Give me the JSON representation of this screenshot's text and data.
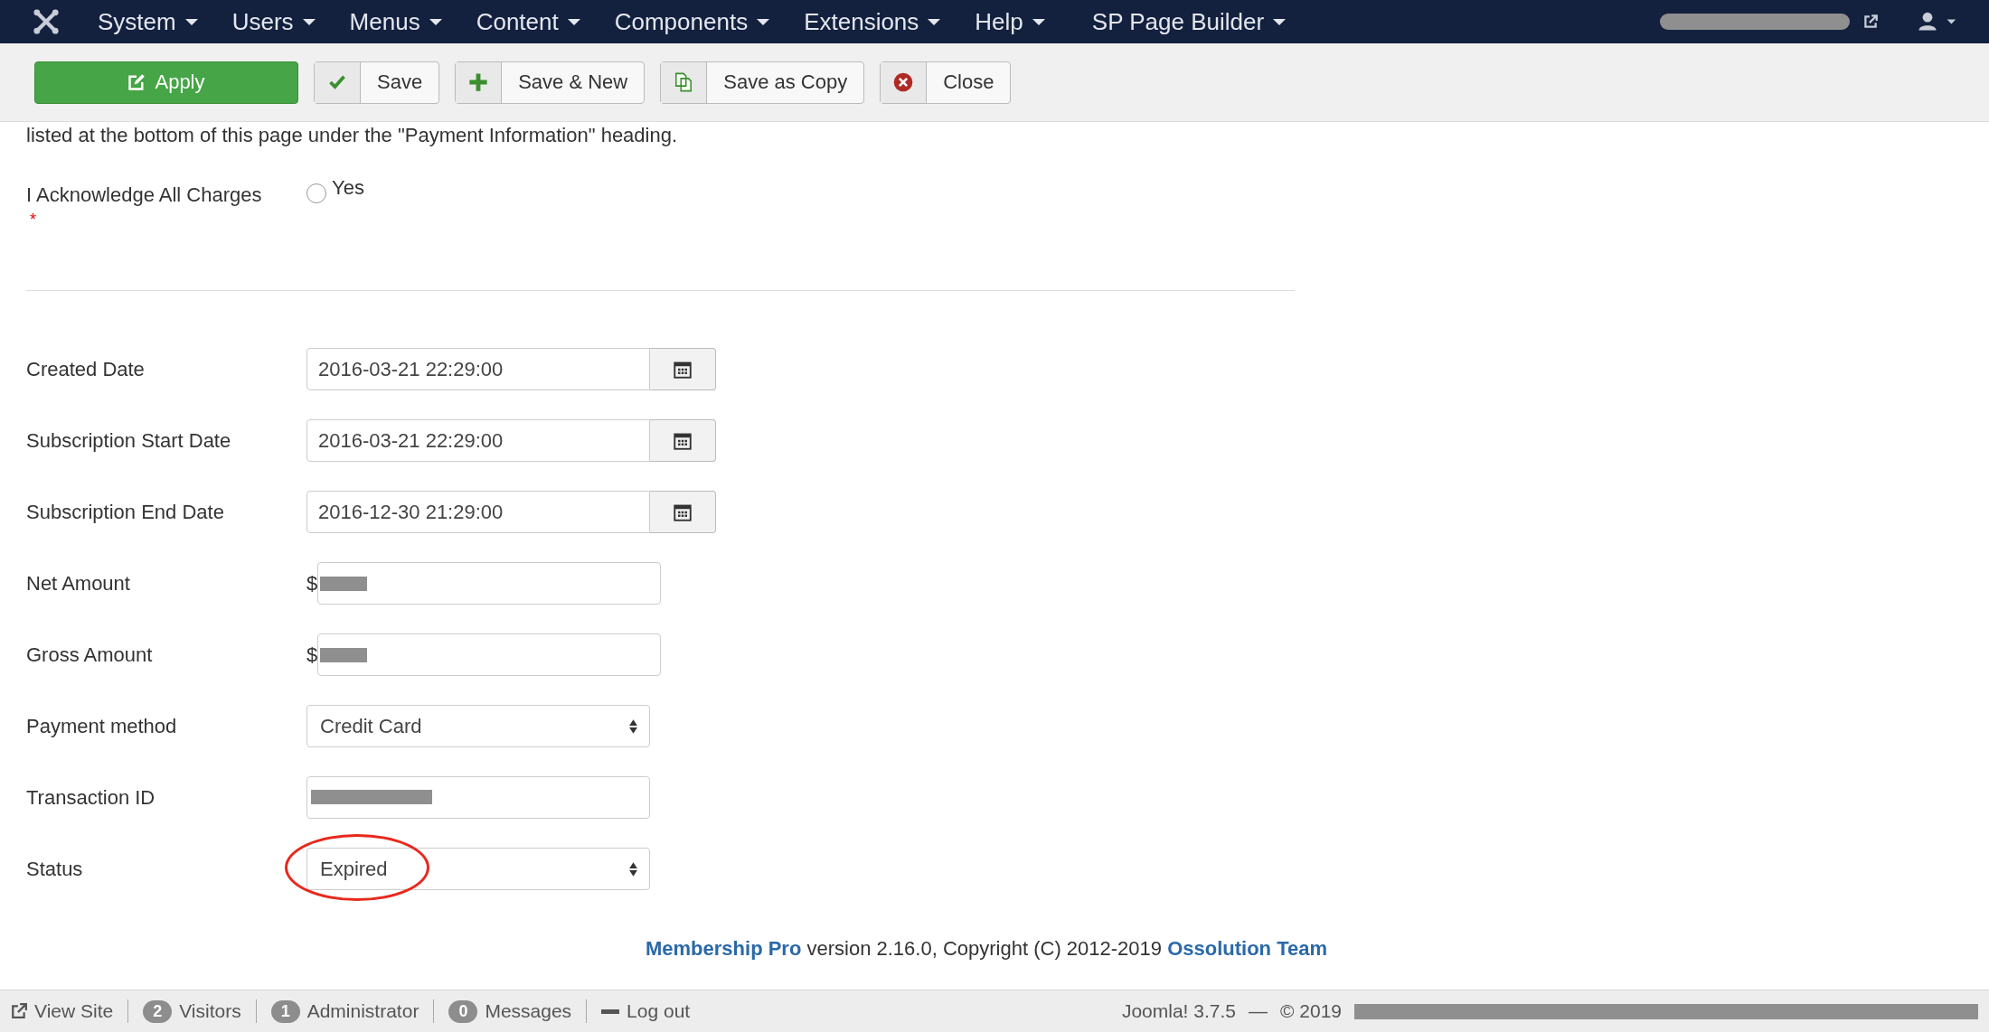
{
  "navbar": {
    "menus": [
      {
        "label": "System"
      },
      {
        "label": "Users"
      },
      {
        "label": "Menus"
      },
      {
        "label": "Content"
      },
      {
        "label": "Components"
      },
      {
        "label": "Extensions"
      },
      {
        "label": "Help"
      },
      {
        "label": "SP Page Builder"
      }
    ],
    "site_link": {
      "redacted": true
    }
  },
  "toolbar": {
    "buttons": [
      {
        "label": "Apply",
        "kind": "apply"
      },
      {
        "label": "Save",
        "kind": "save"
      },
      {
        "label": "Save & New",
        "kind": "new"
      },
      {
        "label": "Save as Copy",
        "kind": "copy"
      },
      {
        "label": "Close",
        "kind": "close"
      }
    ]
  },
  "intro_text": "listed at the bottom of this page under the \"Payment Information\" heading.",
  "acknowledge": {
    "label": "I Acknowledge All Charges",
    "required_mark": "*",
    "option": "Yes",
    "checked": false
  },
  "fields": [
    {
      "label": "Created Date",
      "kind": "date",
      "value": "2016-03-21 22:29:00"
    },
    {
      "label": "Subscription Start Date",
      "kind": "date",
      "value": "2016-03-21 22:29:00"
    },
    {
      "label": "Subscription End Date",
      "kind": "date",
      "value": "2016-12-30 21:29:00"
    },
    {
      "label": "Net Amount",
      "kind": "amount",
      "prefix": "$",
      "redacted": true
    },
    {
      "label": "Gross Amount",
      "kind": "amount",
      "prefix": "$",
      "redacted": true
    },
    {
      "label": "Payment method",
      "kind": "select",
      "value": "Credit Card"
    },
    {
      "label": "Transaction ID",
      "kind": "text",
      "redacted": true
    },
    {
      "label": "Status",
      "kind": "select",
      "value": "Expired",
      "circled": true
    }
  ],
  "footer": {
    "product": "Membership Pro",
    "text": "version 2.16.0, Copyright (C) 2012-2019",
    "team": "Ossolution Team"
  },
  "status_bar": {
    "items": [
      {
        "kind": "view",
        "label": "View Site"
      },
      {
        "kind": "badge",
        "count": "2",
        "label": "Visitors"
      },
      {
        "kind": "badge",
        "count": "1",
        "label": "Administrator"
      },
      {
        "kind": "badge",
        "count": "0",
        "label": "Messages"
      },
      {
        "kind": "logout",
        "label": "Log out"
      }
    ],
    "version": "Joomla! 3.7.5",
    "dash": "—",
    "copyright": "© 2019",
    "owner_redacted": true
  }
}
